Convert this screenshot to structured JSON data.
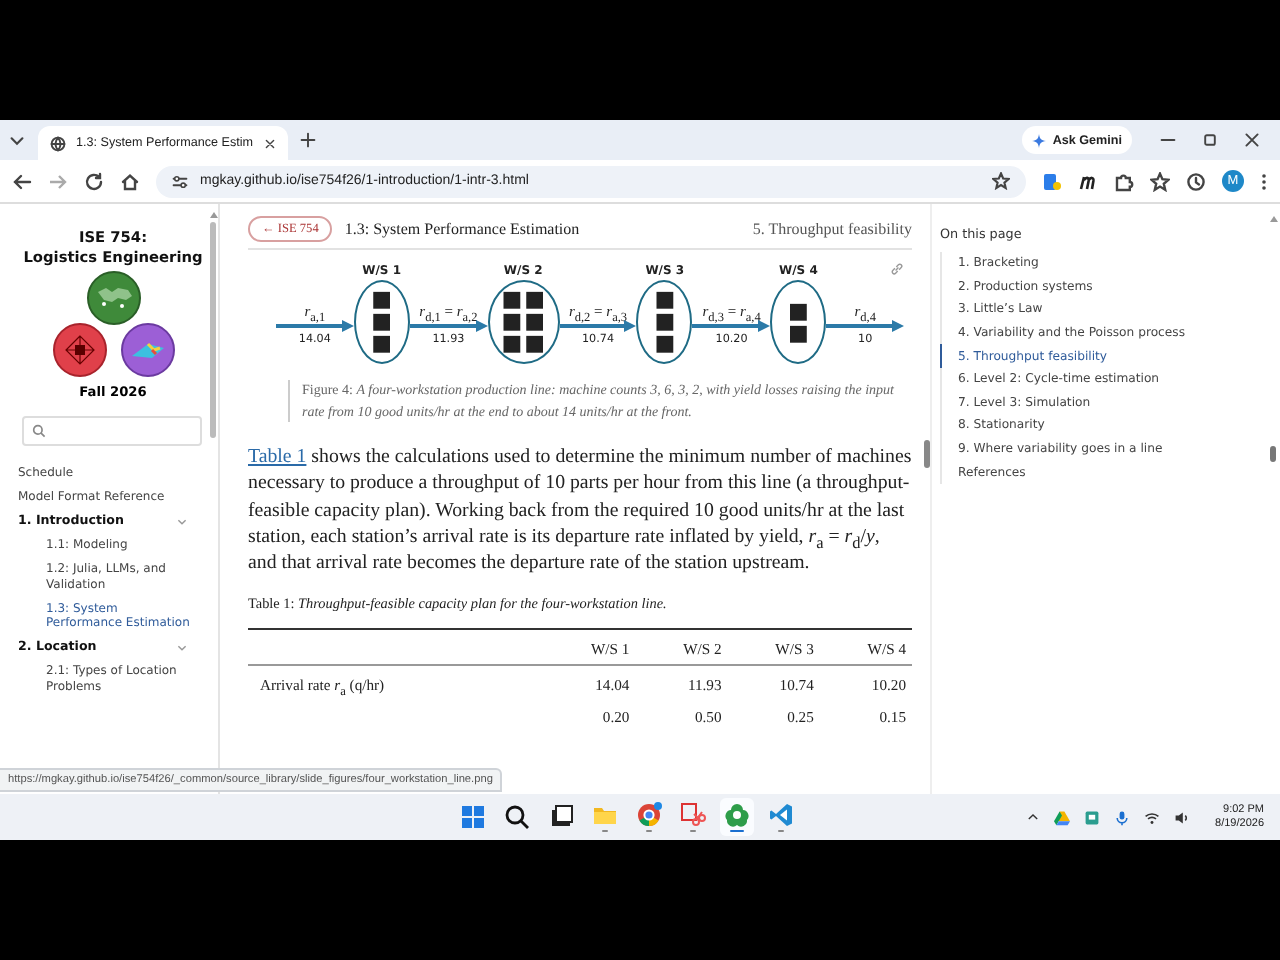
{
  "browser": {
    "tab_title": "1.3: System Performance Estim",
    "assistant_button": "Ask Gemini",
    "url": "mgkay.github.io/ise754f26/1-introduction/1-intr-3.html",
    "profile_initial": "M"
  },
  "sidebar": {
    "title": [
      "ISE 754:",
      "Logistics Engineering"
    ],
    "term": "Fall 2026",
    "nav": [
      {
        "label": "Schedule",
        "kind": "link",
        "selected": false
      },
      {
        "label": "Model Format Reference",
        "kind": "link",
        "selected": false
      },
      {
        "label": "1. Introduction",
        "kind": "section",
        "expanded": true,
        "children": [
          {
            "label": "1.1: Modeling",
            "selected": false
          },
          {
            "label": "1.2: Julia, LLMs, and Validation",
            "selected": false
          },
          {
            "label": "1.3: System Performance Estimation",
            "selected": true
          }
        ]
      },
      {
        "label": "2. Location",
        "kind": "section",
        "expanded": true,
        "children": [
          {
            "label": "2.1: Types of Location Problems",
            "selected": false
          }
        ]
      }
    ]
  },
  "page": {
    "back_link": "← ISE 754",
    "chapter_title": "1.3: System Performance Estimation",
    "section_title": "5. Throughput feasibility",
    "figure": {
      "stations": [
        {
          "label": "W/S 1",
          "machines": [
            "■",
            "■",
            "■"
          ]
        },
        {
          "label": "W/S 2",
          "machines": [
            "■",
            "■",
            "■",
            "■",
            "■",
            "■"
          ]
        },
        {
          "label": "W/S 3",
          "machines": [
            "■",
            "■",
            "■"
          ]
        },
        {
          "label": "W/S 4",
          "machines": [
            "■",
            "■"
          ]
        }
      ],
      "flows": [
        {
          "label": "*r*$_{a,1}$",
          "value": "14.04"
        },
        {
          "label": "*r*$_{d,1}$ = *r*$_{a,2}$",
          "value": "11.93"
        },
        {
          "label": "*r*$_{d,2}$ = *r*$_{a,3}$",
          "value": "10.74"
        },
        {
          "label": "*r*$_{d,3}$ = *r*$_{a,4}$",
          "value": "10.20"
        },
        {
          "label": "*r*$_{d,4}$",
          "value": "10"
        }
      ],
      "caption": "Figure 4: *A four-workstation production line: machine counts 3, 6, 3, 2, with yield losses raising the input rate from 10 good units/hr at the end to about 14 units/hr at the front.*"
    },
    "paragraph": {
      "link": "Table 1",
      "text": " shows the calculations used to determine the minimum number of machines necessary to produce a throughput of 10 parts per hour from this line (a throughput-feasible capacity plan). Working back from the required 10 good units/hr at the last station, each station’s arrival rate is its departure rate inflated by yield, *r*$_{a}$ = *r*$_{d}$/*y*, and that arrival rate becomes the departure rate of the station upstream."
    },
    "table": {
      "caption": "Table 1: *Throughput-feasible capacity plan for the four-workstation line.*",
      "columns": [
        "W/S 1",
        "W/S 2",
        "W/S 3",
        "W/S 4"
      ],
      "rows": [
        {
          "label": "Arrival rate *r*$_{a}$ (q/hr)",
          "cells": [
            "14.04",
            "11.93",
            "10.74",
            "10.20"
          ]
        },
        {
          "cells": [
            "0.20",
            "0.50",
            "0.25",
            "0.15"
          ]
        }
      ]
    }
  },
  "toc": {
    "heading": "On this page",
    "items": [
      {
        "label": "1. Bracketing",
        "selected": false
      },
      {
        "label": "2. Production systems",
        "selected": false
      },
      {
        "label": "3. Little’s Law",
        "selected": false
      },
      {
        "label": "4. Variability and the Poisson process",
        "selected": false
      },
      {
        "label": "5. Throughput feasibility",
        "selected": true
      },
      {
        "label": "6. Level 2: Cycle-time estimation",
        "selected": false
      },
      {
        "label": "7. Level 3: Simulation",
        "selected": false
      },
      {
        "label": "8. Stationarity",
        "selected": false
      },
      {
        "label": "9. Where variability goes in a line",
        "selected": false
      },
      {
        "label": "References",
        "selected": false
      }
    ]
  },
  "status_url": "https://mgkay.github.io/ise754f26/_common/source_library/slide_figures/four_workstation_line.png",
  "taskbar": {
    "apps": [
      {
        "kind": "start",
        "running": false,
        "selected": false
      },
      {
        "kind": "search",
        "running": false,
        "selected": false
      },
      {
        "kind": "taskview",
        "running": false,
        "selected": false
      },
      {
        "kind": "files",
        "running": true,
        "selected": false
      },
      {
        "kind": "chrome",
        "running": true,
        "selected": false
      },
      {
        "kind": "snip",
        "running": true,
        "selected": false
      },
      {
        "kind": "photos",
        "running": true,
        "selected": true
      },
      {
        "kind": "vscode",
        "running": true,
        "selected": false
      }
    ],
    "time": "9:02 PM",
    "date": "8/19/2026"
  }
}
